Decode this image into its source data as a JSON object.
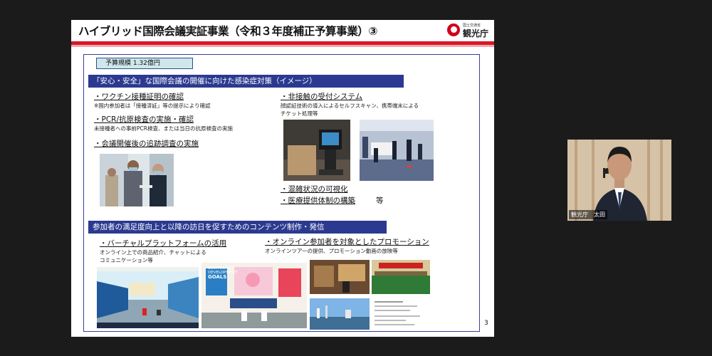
{
  "slide": {
    "title": "ハイブリッド国際会議実証事業（令和３年度補正予算事業）③",
    "logo": {
      "small_text": "国土交通省",
      "text": "観光庁"
    },
    "budget_label": "予算規模 1.32億円",
    "section1": {
      "banner": "「安心・安全」な国際会議の開催に向けた感染症対策（イメージ）",
      "left_items": [
        {
          "label": "・ワクチン接種証明の確認",
          "note": "※国内参加者は「接種済証」等の提示により確認"
        },
        {
          "label": "・PCR/抗原検査の実施・確認",
          "note": "未接種者への事前PCR検査、または当日の抗原検査の実施"
        },
        {
          "label": "・会議開催後の追跡調査の実施",
          "note": ""
        }
      ],
      "right_item": {
        "label": "・非接触の受付システム",
        "note_line1": "顔認証技術の導入によるセルフスキャン、携帯端末による",
        "note_line2": "チケット処理等"
      },
      "bottom_items": [
        "・混雑状況の可視化",
        "・医療提供体制の構築"
      ],
      "bottom_suffix": "等"
    },
    "section2": {
      "banner": "参加者の満足度向上と以降の訪日を促すためのコンテンツ制作・発信",
      "left": {
        "label": "・バーチャルプラットフォームの活用",
        "note_line1": "オンライン上での商品紹介、チャットによる",
        "note_line2": "コミュニケーション等"
      },
      "right": {
        "label": "・オンライン参加者を対象としたプロモーション",
        "note": "オンラインツアーの提供、プロモーション動画の放映等"
      },
      "sdg_text_1": "SUSTAINABLE",
      "sdg_text_2": "DEVELOPMENT",
      "sdg_text_3": "GOALS"
    },
    "page_number": "3"
  },
  "participant": {
    "name": "観光庁　太田"
  }
}
